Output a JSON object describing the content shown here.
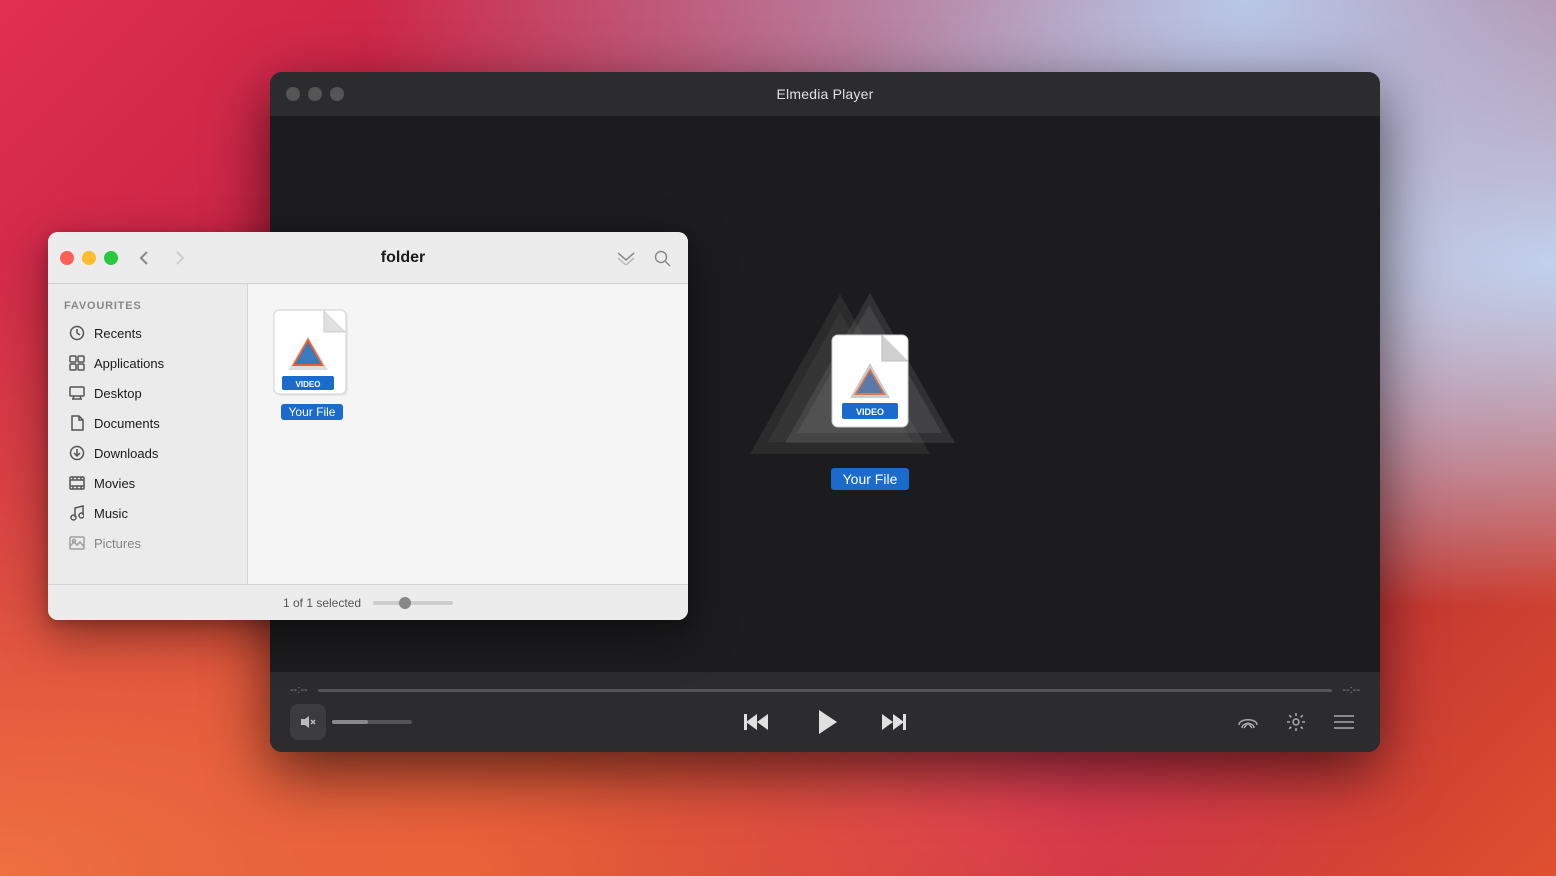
{
  "desktop": {
    "bg": "macOS Big Sur gradient"
  },
  "player": {
    "title": "Elmedia Player",
    "traffic_lights": {
      "close": "close",
      "minimize": "minimize",
      "maximize": "maximize"
    },
    "file_label": "Your File",
    "time_start": "--:--",
    "time_end": "--:--",
    "controls": {
      "prev_label": "previous",
      "play_label": "play",
      "next_label": "next",
      "airplay_label": "airplay",
      "settings_label": "settings",
      "playlist_label": "playlist"
    }
  },
  "finder": {
    "title": "folder",
    "traffic_lights": {
      "close": "close",
      "minimize": "minimize",
      "maximize": "maximize"
    },
    "nav": {
      "back": "‹",
      "forward": "›"
    },
    "sidebar": {
      "section_label": "Favourites",
      "items": [
        {
          "label": "Recents",
          "icon": "clock"
        },
        {
          "label": "Applications",
          "icon": "grid"
        },
        {
          "label": "Desktop",
          "icon": "monitor"
        },
        {
          "label": "Documents",
          "icon": "document"
        },
        {
          "label": "Downloads",
          "icon": "download"
        },
        {
          "label": "Movies",
          "icon": "film"
        },
        {
          "label": "Music",
          "icon": "music"
        },
        {
          "label": "Pictures",
          "icon": "photo"
        }
      ]
    },
    "file": {
      "label": "Your File",
      "type": "VIDEO"
    },
    "statusbar": {
      "selected": "1 of 1 selected"
    }
  }
}
